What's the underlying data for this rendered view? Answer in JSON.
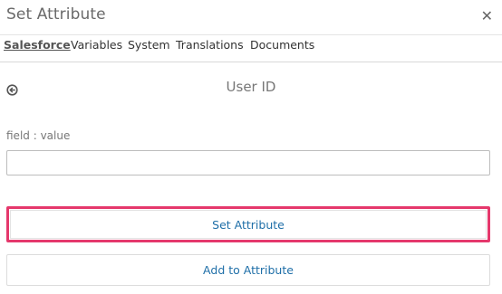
{
  "dialog": {
    "title": "Set Attribute",
    "close_icon": "close-icon"
  },
  "tabs": [
    {
      "label": "Salesforce",
      "active": true
    },
    {
      "label": "Variables",
      "active": false
    },
    {
      "label": "System",
      "active": false
    },
    {
      "label": "Translations",
      "active": false
    },
    {
      "label": "Documents",
      "active": false
    }
  ],
  "content": {
    "heading": "User ID",
    "back_icon": "circle-arrow-left-icon",
    "field_label": "field : value",
    "field_value": "",
    "field_placeholder": ""
  },
  "buttons": {
    "set_attribute": "Set Attribute",
    "add_to_attribute": "Add to Attribute"
  },
  "colors": {
    "highlight": "#e5386c",
    "link": "#1f6fa8"
  }
}
